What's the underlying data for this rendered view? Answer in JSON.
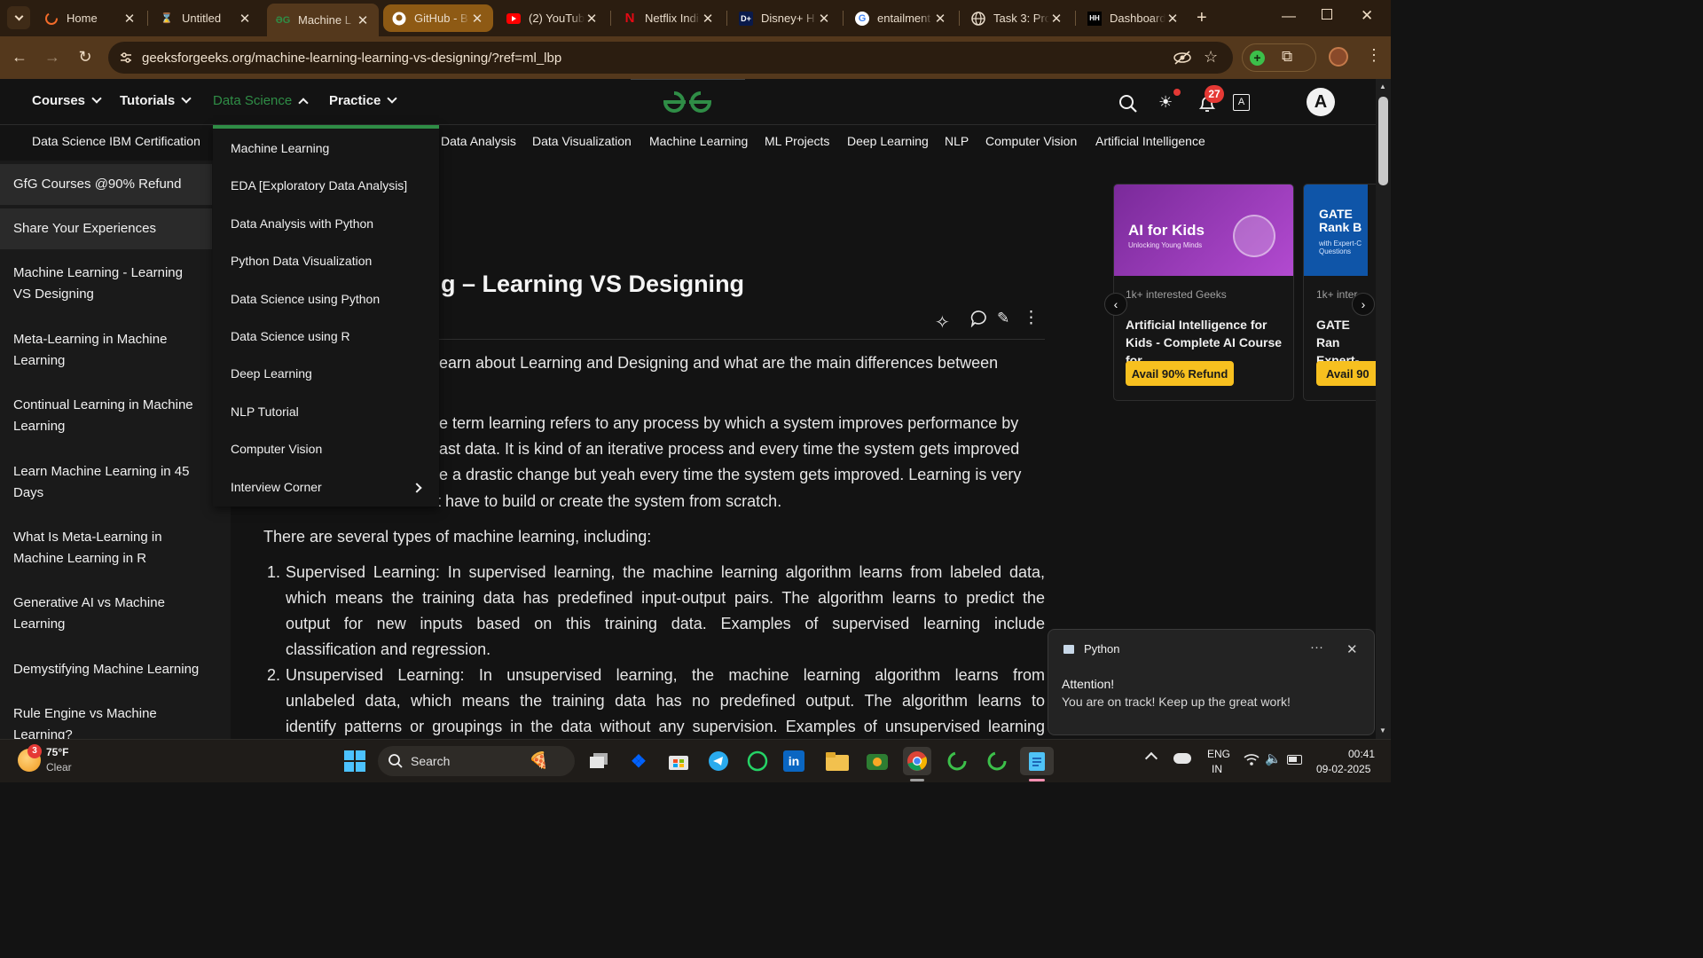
{
  "browser": {
    "tabs": [
      {
        "title": "Home",
        "icon": "loader-icon"
      },
      {
        "title": "Untitled",
        "icon": "hourglass-icon"
      },
      {
        "title": "Machine L",
        "icon": "gfg-icon"
      },
      {
        "title": "GitHub - B",
        "icon": "github-icon"
      },
      {
        "title": "(2) YouTub",
        "icon": "youtube-icon"
      },
      {
        "title": "Netflix Indi",
        "icon": "netflix-icon"
      },
      {
        "title": "Disney+ H",
        "icon": "disney-icon"
      },
      {
        "title": "entailment",
        "icon": "google-icon"
      },
      {
        "title": "Task 3: Pro",
        "icon": "globe-icon"
      },
      {
        "title": "Dashboard",
        "icon": "dashboard-icon"
      }
    ],
    "url": "geeksforgeeks.org/machine-learning-learning-vs-designing/?ref=ml_lbp",
    "accent": "#54381c"
  },
  "header": {
    "nav": [
      {
        "label": "Courses"
      },
      {
        "label": "Tutorials"
      },
      {
        "label": "Data Science"
      },
      {
        "label": "Practice"
      }
    ],
    "notification_count": "27",
    "avatar_letter": "A"
  },
  "subnav": {
    "items": [
      "Data Science IBM Certification",
      "Data Analysis",
      "Data Visualization",
      "Machine Learning",
      "ML Projects",
      "Deep Learning",
      "NLP",
      "Computer Vision",
      "Artificial Intelligence"
    ]
  },
  "dropdown": {
    "items": [
      "Machine Learning",
      "EDA [Exploratory Data Analysis]",
      "Data Analysis with Python",
      "Python Data Visualization",
      "Data Science using Python",
      "Data Science using R",
      "Deep Learning",
      "NLP Tutorial",
      "Computer Vision",
      "Interview Corner"
    ]
  },
  "sidebar": {
    "items": [
      "GfG Courses @90% Refund",
      "Share Your Experiences",
      "Machine Learning - Learning VS Designing",
      "Meta-Learning in Machine Learning",
      "Continual Learning in Machine Learning",
      "Learn Machine Learning in 45 Days",
      "What Is Meta-Learning in Machine Learning in R",
      "Generative AI vs Machine Learning",
      "Demystifying Machine Learning",
      "Rule Engine vs Machine Learning?"
    ]
  },
  "article": {
    "title_visible": "g – Learning VS Designing",
    "intro_visible": "earn about Learning and Designing and what are the main differences between",
    "learning_lines": [
      "e term learning refers to any process by which a system improves performance by",
      "ast data. It is kind of an iterative process and every time the system gets improved",
      "e a drastic change but yeah every time the system gets improved. Learning is very",
      "don’t have to build or create the system from scratch."
    ],
    "types_intro": "There are several types of machine learning, including:",
    "list": [
      {
        "num": "1.",
        "lines": [
          "Supervised Learning: In supervised learning, the machine learning algorithm learns from labeled data,",
          "which means the training data has predefined input-output pairs. The algorithm learns to predict the",
          "output for new inputs based on this training data. Examples of supervised learning include",
          "classification and regression."
        ]
      },
      {
        "num": "2.",
        "lines": [
          "Unsupervised Learning: In unsupervised learning, the machine learning algorithm learns from",
          "unlabeled data, which means the training data has no predefined output. The algorithm learns to",
          "identify patterns or groupings in the data without any supervision. Examples of unsupervised learning"
        ]
      }
    ]
  },
  "cards": [
    {
      "banner_title": "AI for Kids",
      "banner_sub": "Unlocking Young Minds",
      "interest": "1k+ interested Geeks",
      "title": "Artificial Intelligence for Kids - Complete AI Course for...",
      "button": "Avail 90% Refund",
      "color": "#8a2fa8"
    },
    {
      "banner_title": "GATE Rank B",
      "banner_sub": "with Expert-C Questions",
      "interest": "1k+ inter",
      "title": "GATE Ran Expert-Cu",
      "button": "Avail 90",
      "color": "#0f55a8"
    }
  ],
  "toast": {
    "app": "Python",
    "title": "Attention!",
    "message": "You are on track! Keep up the great work!"
  },
  "taskbar": {
    "weather_temp": "75°F",
    "weather_desc": "Clear",
    "weather_badge": "3",
    "search_placeholder": "Search",
    "lang1": "ENG",
    "lang2": "IN",
    "time": "00:41",
    "date": "09-02-2025"
  }
}
